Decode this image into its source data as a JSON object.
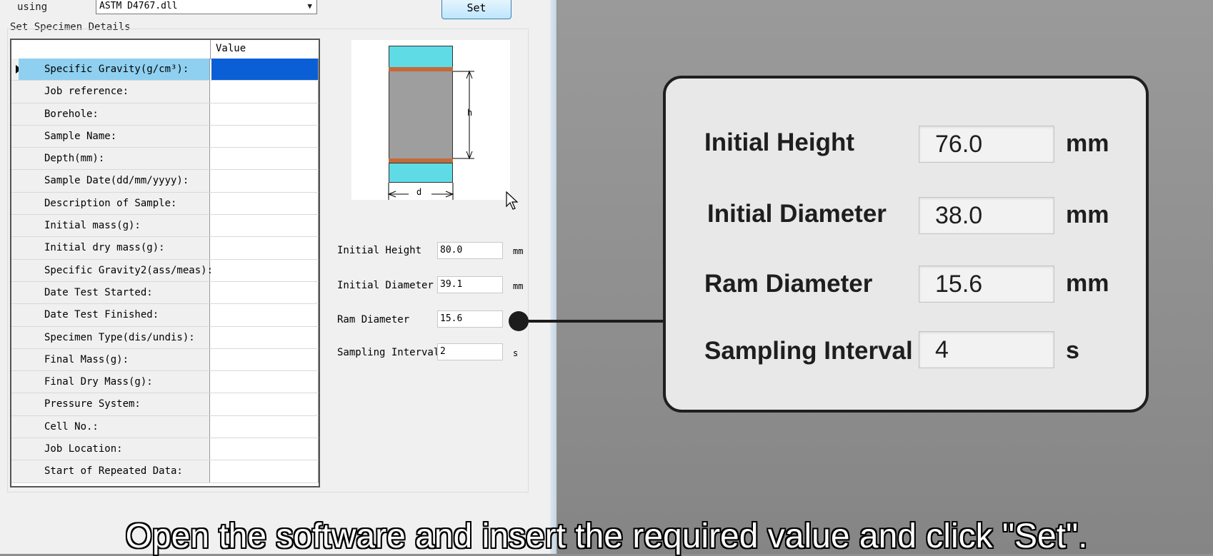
{
  "top": {
    "using_label": "using",
    "dll_selected": "ASTM D4767.dll",
    "set_label": "Set"
  },
  "section_title": "Set Specimen Details",
  "grid": {
    "value_header": "Value",
    "rows": [
      {
        "label": "Specific Gravity(g/cm³):",
        "value": ""
      },
      {
        "label": "Job reference:",
        "value": ""
      },
      {
        "label": "Borehole:",
        "value": ""
      },
      {
        "label": "Sample Name:",
        "value": ""
      },
      {
        "label": "Depth(mm):",
        "value": ""
      },
      {
        "label": "Sample Date(dd/mm/yyyy):",
        "value": ""
      },
      {
        "label": "Description of Sample:",
        "value": ""
      },
      {
        "label": "Initial mass(g):",
        "value": ""
      },
      {
        "label": "Initial dry mass(g):",
        "value": ""
      },
      {
        "label": "Specific Gravity2(ass/meas):",
        "value": ""
      },
      {
        "label": "Date Test Started:",
        "value": ""
      },
      {
        "label": "Date Test Finished:",
        "value": ""
      },
      {
        "label": "Specimen Type(dis/undis):",
        "value": ""
      },
      {
        "label": "Final Mass(g):",
        "value": ""
      },
      {
        "label": "Final Dry Mass(g):",
        "value": ""
      },
      {
        "label": "Pressure System:",
        "value": ""
      },
      {
        "label": "Cell No.:",
        "value": ""
      },
      {
        "label": "Job Location:",
        "value": ""
      },
      {
        "label": "Start of Repeated Data:",
        "value": ""
      }
    ]
  },
  "diagram": {
    "h_label": "h",
    "d_label": "d"
  },
  "params": {
    "height": {
      "label": "Initial Height",
      "value": "80.0",
      "unit": "mm"
    },
    "diameter": {
      "label": "Initial Diameter",
      "value": "39.1",
      "unit": "mm"
    },
    "ram": {
      "label": "Ram Diameter",
      "value": "15.6",
      "unit": ""
    },
    "interval": {
      "label": "Sampling Interval",
      "value": "2",
      "unit": "s"
    }
  },
  "callout": {
    "height": {
      "label": "Initial Height",
      "value": "76.0",
      "unit": "mm"
    },
    "diameter": {
      "label": "Initial Diameter",
      "value": "38.0",
      "unit": "mm"
    },
    "ram": {
      "label": "Ram Diameter",
      "value": "15.6",
      "unit": "mm"
    },
    "interval": {
      "label": "Sampling Interval",
      "value": "4",
      "unit": "s"
    }
  },
  "caption": "Open the software and insert the required value and click \"Set\"."
}
